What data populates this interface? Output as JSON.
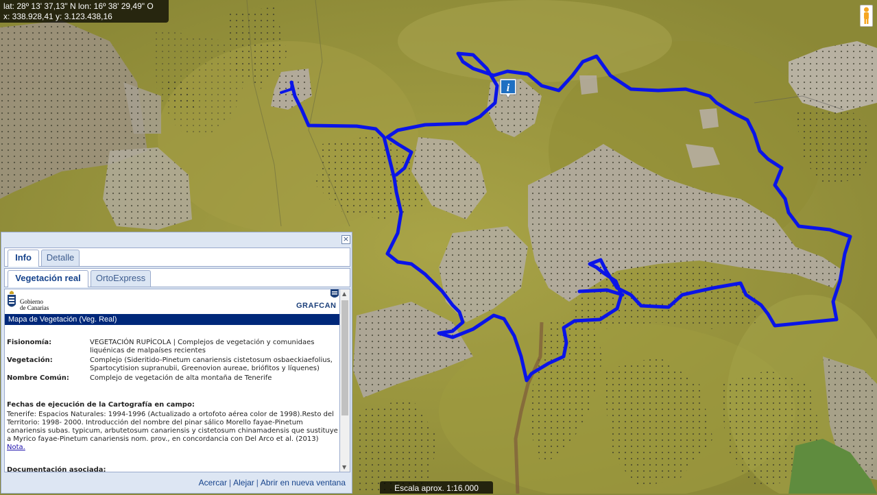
{
  "coords": {
    "latlon": "lat: 28º 13' 37,13\" N  lon: 16º 38' 29,49\" O",
    "xy": "x: 338.928,41  y: 3.123.438,16"
  },
  "scale": "Escala aprox. 1:16.000",
  "map": {
    "route_color": "#0a14e8",
    "icons": [
      "pegman-icon",
      "info-marker-icon"
    ]
  },
  "panel": {
    "tabs_top": [
      {
        "label": "Info",
        "active": true
      },
      {
        "label": "Detalle",
        "active": false
      }
    ],
    "tabs_sub": [
      {
        "label": "Vegetación real",
        "active": true
      },
      {
        "label": "OrtoExpress",
        "active": false
      }
    ],
    "gobierno_line1": "Gobierno",
    "gobierno_line2": "de Canarias",
    "grafcan": "GRAFCAN",
    "title": "Mapa de Vegetación (Veg. Real)",
    "fields": [
      {
        "key": "Fisionomía:",
        "value": "VEGETACIÓN RUPÍCOLA | Complejos de vegetación y comunidaes liquénicas de malpaíses recientes"
      },
      {
        "key": "Vegetación:",
        "value": "Complejo (Sideritido-Pinetum canariensis cistetosum osbaeckiaefolius, Spartocytision supranubii, Greenovion aureae, briófitos y líquenes)"
      },
      {
        "key": "Nombre Común:",
        "value": "Complejo de vegetación de alta montaña de Tenerife"
      }
    ],
    "fechas_head": "Fechas de ejecución de la Cartografía en campo:",
    "fechas_body": "Tenerife: Espacios Naturales: 1994-1996 (Actualizado a ortofoto aérea color de 1998).Resto del Territorio: 1998- 2000. Introducción del nombre del pinar sálico Morello fayae-Pinetum canariensis subas. typicum, arbutetosum canariensis y cistetosum chinamadensis que sustituye a Myrico fayae-Pinetum canariensis nom. prov., en concordancia con Del Arco et al. (2013)",
    "nota": "Nota.",
    "doc_head": "Documentación asociada:",
    "links": [
      "Acercar",
      "Alejar",
      "Abrir en nueva ventana"
    ]
  }
}
